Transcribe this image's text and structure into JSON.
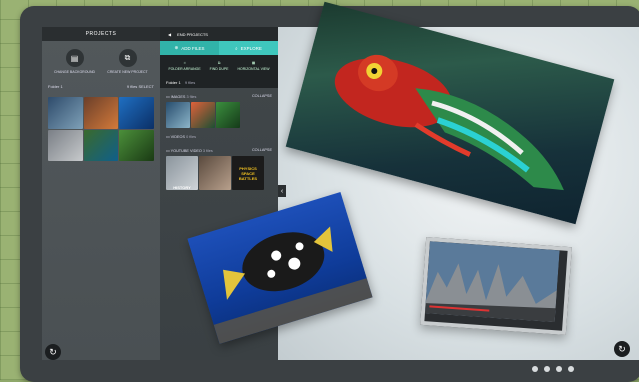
{
  "projects_panel": {
    "title": "PROJECTS",
    "actions": [
      {
        "label": "CHANGE BACKGROUND",
        "icon": "image-icon"
      },
      {
        "label": "CREATE NEW PROJECT",
        "icon": "new-project-icon"
      }
    ],
    "folder_label": "Folder 1",
    "folder_count": "9 files",
    "select_label": "SELECT"
  },
  "folder_panel": {
    "back_label": "END PROJECTS",
    "tabs": [
      {
        "label": "ADD FILES",
        "icon": "plus-icon"
      },
      {
        "label": "EXPLORE",
        "icon": "search-icon"
      }
    ],
    "tools": [
      {
        "label": "FOLDER ARRANGE",
        "icon": "arrange-icon"
      },
      {
        "label": "FIND DUPE",
        "icon": "duplicate-icon"
      },
      {
        "label": "HORIZONTAL VIEW",
        "icon": "grid-icon"
      }
    ],
    "folder_title": "Folder 1",
    "folder_count": "9 files",
    "sections": [
      {
        "label": "IMAGES",
        "count": "3 files",
        "action": "COLLAPSE"
      },
      {
        "label": "VIDEOS",
        "count": "0 files",
        "action": ""
      },
      {
        "label": "YOUTUBE VIDEO",
        "count": "3 files",
        "action": "COLLAPSE"
      }
    ]
  },
  "colors": {
    "accent": "#3fc7bd",
    "panel_dark": "#3a4043",
    "device": "#3b4043"
  },
  "thumbnails": {
    "projects_grid": [
      "#2e4b6b",
      "#6b3f2a",
      "#1f6fc2",
      "#7a7f86",
      "#3a6a2c",
      "#4b8f3a"
    ],
    "images": [
      "#274d6e",
      "#e0613a",
      "#3b8f3e"
    ],
    "youtube": [
      "#8a949c",
      "#5a4a3e",
      "#1b1b1b"
    ]
  },
  "youtube_text": [
    "HISTORY",
    "",
    "PHYSICS SPACE BATTLES"
  ],
  "pager": {
    "count": 4
  }
}
